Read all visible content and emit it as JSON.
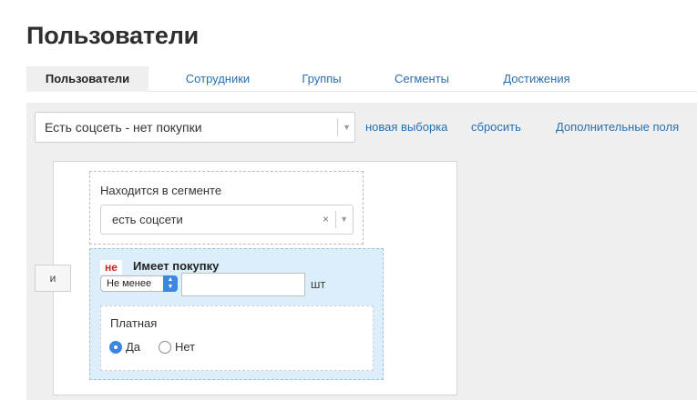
{
  "page": {
    "title": "Пользователи"
  },
  "tabs": [
    {
      "label": "Пользователи",
      "active": true
    },
    {
      "label": "Сотрудники"
    },
    {
      "label": "Группы"
    },
    {
      "label": "Сегменты"
    },
    {
      "label": "Достижения"
    }
  ],
  "filter": {
    "selected": "Есть соцсеть - нет покупки",
    "new_selection": "новая выборка",
    "reset": "сбросить",
    "extra_fields": "Дополнительные поля"
  },
  "conditions": {
    "and_label": "и",
    "segment": {
      "label": "Находится в сегменте",
      "value": "есть соцсети",
      "clear": "×"
    },
    "purchase": {
      "not_label": "не",
      "title": "Имеет покупку",
      "mode": "Не менее",
      "quantity": "",
      "unit": "шт",
      "paid": {
        "label": "Платная",
        "options": [
          "Да",
          "Нет"
        ],
        "selected": "Да"
      }
    }
  },
  "colors": {
    "link": "#2a6fb0",
    "accent": "#3b86e0",
    "negation": "#d41a1a",
    "highlight_bg": "#ddeefb"
  },
  "icons": {
    "dropdown": "chevron-down-icon",
    "stepper": "updown-arrows-icon",
    "clear": "close-icon"
  }
}
